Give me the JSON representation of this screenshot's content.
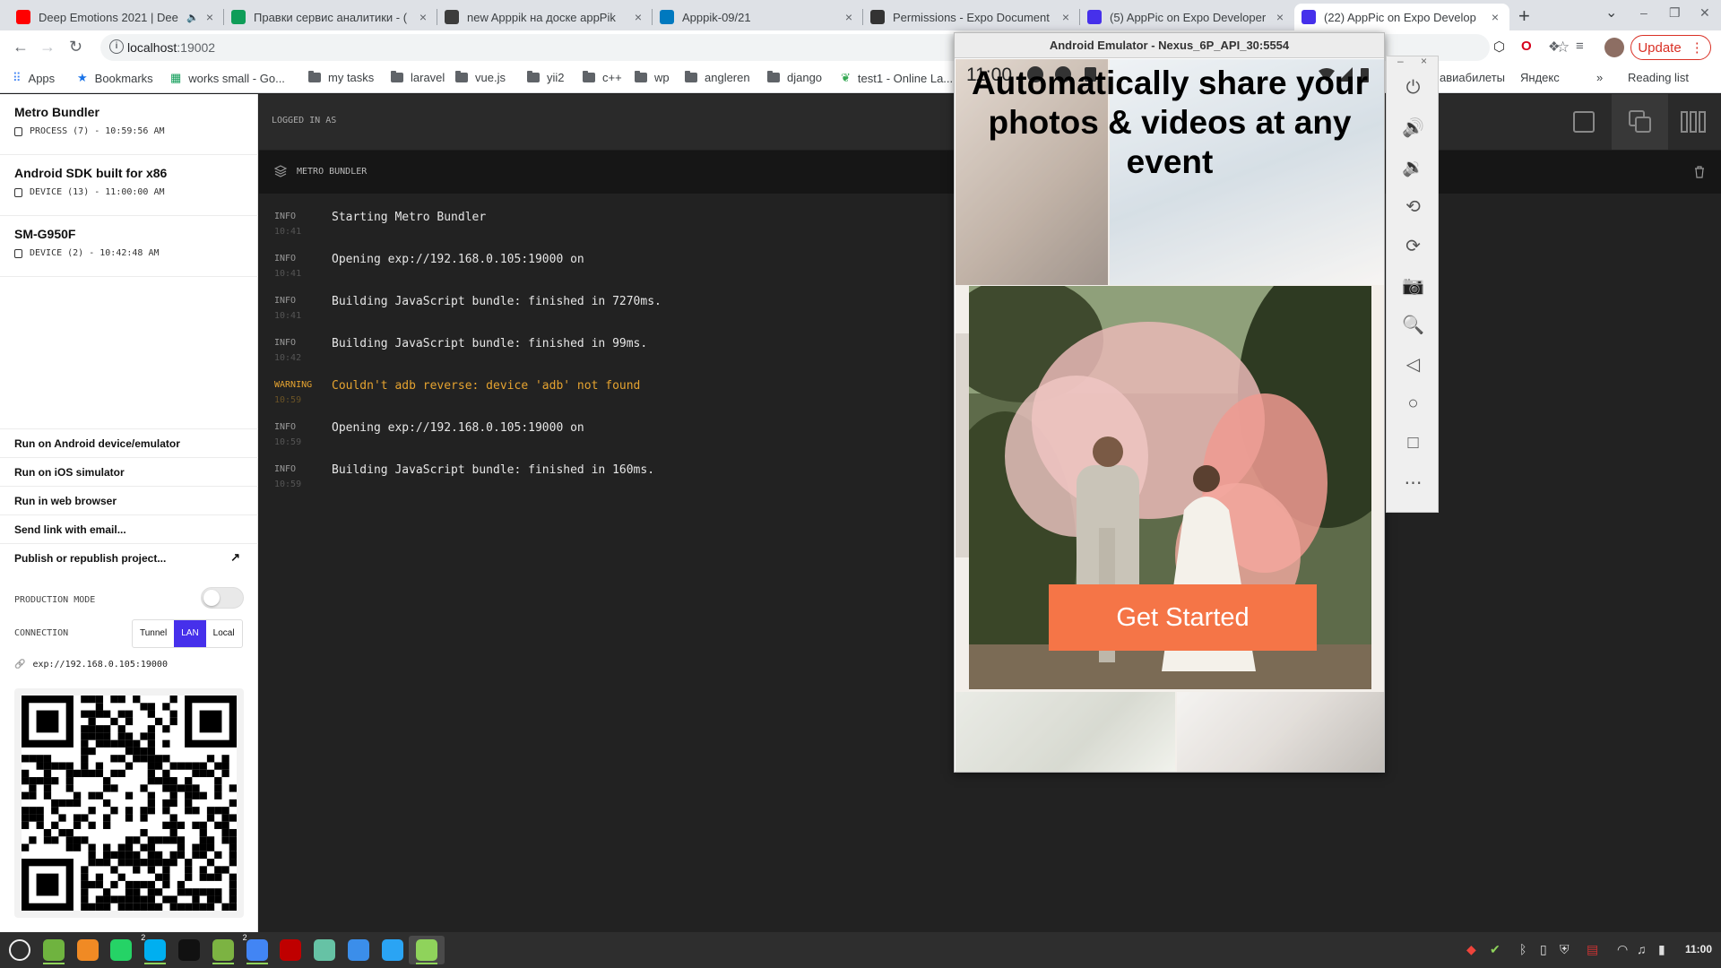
{
  "browser": {
    "tabs": [
      {
        "label": "Deep Emotions 2021 | Dee",
        "icon": "youtube-icon",
        "color": "#ff0000",
        "active": false
      },
      {
        "label": "Правки сервис аналитики - (",
        "icon": "google-sheets-icon",
        "color": "#0f9d58",
        "active": false
      },
      {
        "label": "new Apppik на доске appPik",
        "icon": "trello-board-icon",
        "color": "#3c3c3c",
        "active": false
      },
      {
        "label": "Apppik-09/21",
        "icon": "trello-icon",
        "color": "#0079bf",
        "active": false
      },
      {
        "label": "Permissions - Expo Document",
        "icon": "expo-icon",
        "color": "#333333",
        "active": false
      },
      {
        "label": "(5) AppPic on Expo Developer",
        "icon": "expo-icon",
        "color": "#4630eb",
        "active": false
      },
      {
        "label": "(22) AppPic on Expo Develop",
        "icon": "expo-icon",
        "color": "#4630eb",
        "active": true
      }
    ],
    "url_host": "localhost",
    "url_port": ":19002",
    "update_label": "Update",
    "bookmarks": [
      {
        "label": "Apps",
        "kind": "apps"
      },
      {
        "label": "Bookmarks",
        "kind": "star"
      },
      {
        "label": "works small - Go...",
        "kind": "sheet"
      },
      {
        "label": "my tasks",
        "kind": "folder"
      },
      {
        "label": "laravel",
        "kind": "folder"
      },
      {
        "label": "vue.js",
        "kind": "folder"
      },
      {
        "label": "yii2",
        "kind": "folder"
      },
      {
        "label": "c++",
        "kind": "folder"
      },
      {
        "label": "wp",
        "kind": "folder"
      },
      {
        "label": "angleren",
        "kind": "folder"
      },
      {
        "label": "django",
        "kind": "folder"
      },
      {
        "label": "test1 - Online La...",
        "kind": "leaf"
      }
    ],
    "bookmarks_right": [
      "авиабилеты",
      "Яндекс",
      "»",
      "Reading list"
    ]
  },
  "devtools": {
    "processes": [
      {
        "title": "Metro Bundler",
        "meta": "PROCESS (7) - 10:59:56 AM"
      },
      {
        "title": "Android SDK built for x86",
        "meta": "DEVICE (13) - 11:00:00 AM"
      },
      {
        "title": "SM-G950F",
        "meta": "DEVICE (2) - 10:42:48 AM"
      }
    ],
    "actions": [
      "Run on Android device/emulator",
      "Run on iOS simulator",
      "Run in web browser",
      "Send link with email...",
      "Publish or republish project..."
    ],
    "production_mode_label": "PRODUCTION MODE",
    "production_mode": false,
    "connection_label": "CONNECTION",
    "connection_options": [
      "Tunnel",
      "LAN",
      "Local"
    ],
    "connection_selected": "LAN",
    "exp_url": "exp://192.168.0.105:19000",
    "logged_in_label": "LOGGED IN AS",
    "log_title": "METRO BUNDLER",
    "logs": [
      {
        "level": "INFO",
        "time": "10:41",
        "message": "Starting Metro Bundler"
      },
      {
        "level": "INFO",
        "time": "10:41",
        "message": "Opening exp://192.168.0.105:19000 on"
      },
      {
        "level": "INFO",
        "time": "10:41",
        "message": "Building JavaScript bundle: finished in 7270ms."
      },
      {
        "level": "INFO",
        "time": "10:42",
        "message": "Building JavaScript bundle: finished in 99ms."
      },
      {
        "level": "WARNING",
        "time": "10:59",
        "message": "Couldn't adb reverse: device 'adb' not found"
      },
      {
        "level": "INFO",
        "time": "10:59",
        "message": "Opening exp://192.168.0.105:19000 on"
      },
      {
        "level": "INFO",
        "time": "10:59",
        "message": "Building JavaScript bundle: finished in 160ms."
      }
    ]
  },
  "emulator": {
    "title": "Android Emulator - Nexus_6P_API_30:5554",
    "status_time": "11:00",
    "headline": "Automatically share your photos & videos at any event",
    "cta_label": "Get Started",
    "cta_color": "#f57547",
    "tools": [
      "power-icon",
      "volume-up-icon",
      "volume-down-icon",
      "rotate-left-icon",
      "rotate-right-icon",
      "camera-icon",
      "zoom-icon",
      "back-icon",
      "home-icon",
      "overview-icon",
      "more-icon"
    ]
  },
  "taskbar": {
    "apps": [
      "mint-menu-icon",
      "files-icon",
      "firefox-icon",
      "whatsapp-icon",
      "skype-icon",
      "terminal-icon",
      "folder-icon",
      "chrome-icon",
      "filezilla-icon",
      "atom-icon",
      "phpstorm-icon",
      "webstorm-icon",
      "android-studio-icon"
    ],
    "skype_badge": "2",
    "chrome_badge": "2",
    "clock": "11:00"
  }
}
